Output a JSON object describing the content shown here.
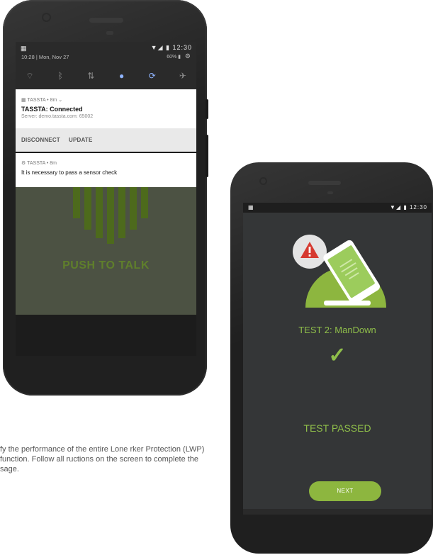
{
  "phone_left": {
    "status_bar": {
      "time": "12:30",
      "signal": "▼◢ ▮"
    },
    "quick_settings": {
      "date": "10:28 | Mon, Nov 27",
      "battery": "60% ▮",
      "icons": [
        "wifi-icon",
        "bluetooth-icon",
        "data-icon",
        "location-icon",
        "rotate-icon",
        "airplane-icon"
      ]
    },
    "notification_connected": {
      "app": "TASSTA • 8m ⌄",
      "title": "TASSTA: Connected",
      "text": "Server: demo.tassta.com: 65002",
      "actions": [
        "DISCONNECT",
        "UPDATE"
      ]
    },
    "notification_sensor": {
      "app": "TASSTA • 8m",
      "text": "It is necessary to pass a sensor check"
    },
    "app": {
      "ptt_label": "PUSH TO TALK",
      "bar_heights": [
        0.55,
        0.75,
        0.9,
        1.0,
        0.9,
        0.75,
        0.55
      ]
    }
  },
  "caption": {
    "text": "fy the performance of the entire Lone rker Protection (LWP) function. Follow all ructions on the screen to complete the sage."
  },
  "phone_right": {
    "status_bar": {
      "time": "12:30",
      "signal": "▼◢ ▮"
    },
    "test_title": "TEST 2: ManDown",
    "check": "✓",
    "result": "TEST PASSED",
    "next_label": "NEXT",
    "colors": {
      "accent": "#8fbe4a",
      "background": "#343637",
      "warning": "#d63a30"
    }
  }
}
